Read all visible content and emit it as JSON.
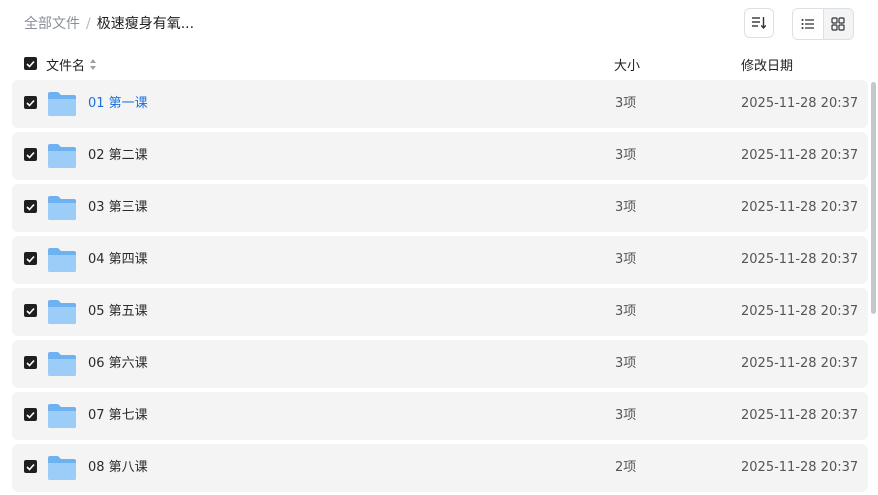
{
  "breadcrumb": {
    "root": "全部文件",
    "separator": "/",
    "current": "极速瘦身有氧..."
  },
  "columns": {
    "name": "文件名",
    "size": "大小",
    "modified": "修改日期"
  },
  "rows": [
    {
      "name": "01 第一课",
      "size": "3项",
      "modified": "2025-11-28 20:37"
    },
    {
      "name": "02 第二课",
      "size": "3项",
      "modified": "2025-11-28 20:37"
    },
    {
      "name": "03 第三课",
      "size": "3项",
      "modified": "2025-11-28 20:37"
    },
    {
      "name": "04 第四课",
      "size": "3项",
      "modified": "2025-11-28 20:37"
    },
    {
      "name": "05 第五课",
      "size": "3项",
      "modified": "2025-11-28 20:37"
    },
    {
      "name": "06 第六课",
      "size": "3项",
      "modified": "2025-11-28 20:37"
    },
    {
      "name": "07 第七课",
      "size": "3项",
      "modified": "2025-11-28 20:37"
    },
    {
      "name": "08 第八课",
      "size": "2项",
      "modified": "2025-11-28 20:37"
    }
  ],
  "colors": {
    "link": "#1e6fd9",
    "row_bg": "#f4f4f5",
    "folder": "#7ab8f5"
  },
  "icons": {
    "sort": "sort-icon",
    "list_view": "list-view-icon",
    "grid_view": "grid-view-icon",
    "folder": "folder-icon",
    "checkbox": "checkbox-checked-icon"
  }
}
